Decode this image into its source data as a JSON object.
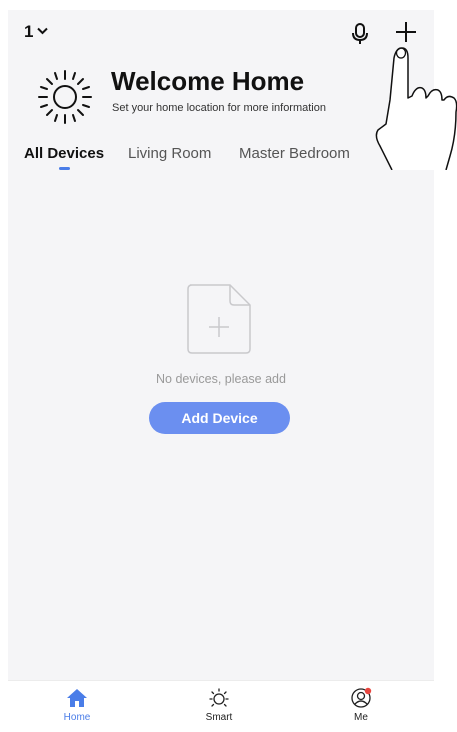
{
  "header": {
    "home_number": "1",
    "chevron_icon": "chevron-down-icon",
    "mic_icon": "microphone-icon",
    "add_icon": "plus-icon"
  },
  "welcome": {
    "title": "Welcome Home",
    "subtitle": "Set your home location for more information",
    "icon": "sun-icon"
  },
  "tabs": [
    {
      "label": "All Devices",
      "active": true
    },
    {
      "label": "Living Room",
      "active": false
    },
    {
      "label": "Master Bedroom",
      "active": false
    }
  ],
  "empty_state": {
    "icon": "add-file-icon",
    "message": "No devices, please add",
    "button_label": "Add Device"
  },
  "bottom_nav": [
    {
      "label": "Home",
      "icon": "home-icon",
      "active": true
    },
    {
      "label": "Smart",
      "icon": "sun-icon",
      "active": false
    },
    {
      "label": "Me",
      "icon": "user-icon",
      "active": false,
      "badge": true
    }
  ],
  "colors": {
    "accent": "#4a7de8",
    "button": "#6b8ff0",
    "background": "#f5f5f7",
    "badge": "#e8463f"
  }
}
